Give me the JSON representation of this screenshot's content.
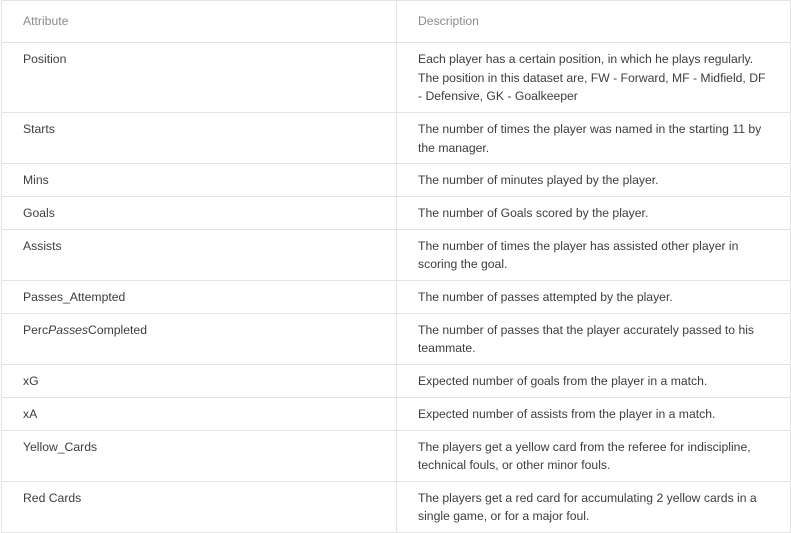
{
  "table": {
    "headers": [
      "Attribute",
      "Description"
    ],
    "rows": [
      {
        "attribute": "Position",
        "description": "Each player has a certain position, in which he plays regularly. The position in this dataset are, FW - Forward, MF - Midfield, DF - Defensive, GK - Goalkeeper"
      },
      {
        "attribute": "Starts",
        "description": "The number of times the player was named in the starting 11 by the manager."
      },
      {
        "attribute": "Mins",
        "description": "The number of minutes played by the player."
      },
      {
        "attribute": "Goals",
        "description": "The number of Goals scored by the player."
      },
      {
        "attribute": "Assists",
        "description": "The number of times the player has assisted other player in scoring the goal."
      },
      {
        "attribute": "Passes_Attempted",
        "description": "The number of passes attempted by the player."
      },
      {
        "attribute_parts": [
          "Perc",
          "Passes",
          "Completed"
        ],
        "description": "The number of passes that the player accurately passed to his teammate."
      },
      {
        "attribute": "xG",
        "description": "Expected number of goals from the player in a match."
      },
      {
        "attribute": "xA",
        "description": "Expected number of assists from the player in a match."
      },
      {
        "attribute": "Yellow_Cards",
        "description": "The players get a yellow card from the referee for indiscipline, technical fouls, or other minor fouls."
      },
      {
        "attribute": "Red Cards",
        "description": "The players get a red card for accumulating 2 yellow cards in a single game, or for a major foul."
      }
    ]
  }
}
